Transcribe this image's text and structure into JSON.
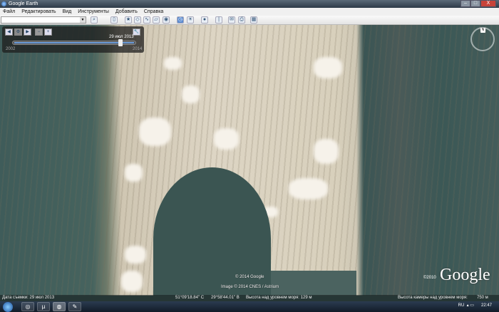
{
  "window": {
    "title": "Google Earth",
    "minimize": "–",
    "maximize": "□",
    "close": "X"
  },
  "menu": [
    "Файл",
    "Редактировать",
    "Вид",
    "Инструменты",
    "Добавить",
    "Справка"
  ],
  "search": {
    "value": "",
    "placeholder": ""
  },
  "toolbar_icons": [
    "search-icon",
    "sidebar-icon",
    "placemark-icon",
    "polygon-icon",
    "path-icon",
    "overlay-icon",
    "tour-icon",
    "historical-imagery-icon",
    "sun-icon",
    "planets-icon",
    "ruler-icon",
    "email-icon",
    "print-icon",
    "maps-icon"
  ],
  "timeline": {
    "date": "29 июл 2013",
    "start_year": "2002",
    "end_year": "2014",
    "position_fraction": 0.92
  },
  "compass": {
    "north": "N"
  },
  "copyright": {
    "line1": "© 2014 Google",
    "line2": "Image © 2014 CNES / Astrium",
    "year": "©2010",
    "logo": "Google"
  },
  "status": {
    "capture_date": "Дата съемки: 29 июл 2013",
    "lat": "51°09'18.84\" С",
    "lon": "29°58'44.01\" В",
    "elevation": "Высота над уровнем моря: 129 м",
    "eye_alt_label": "Высота камеры над уровнем моря:",
    "eye_alt": "750 м"
  },
  "taskbar": {
    "lang": "RU",
    "time": "22:47"
  }
}
